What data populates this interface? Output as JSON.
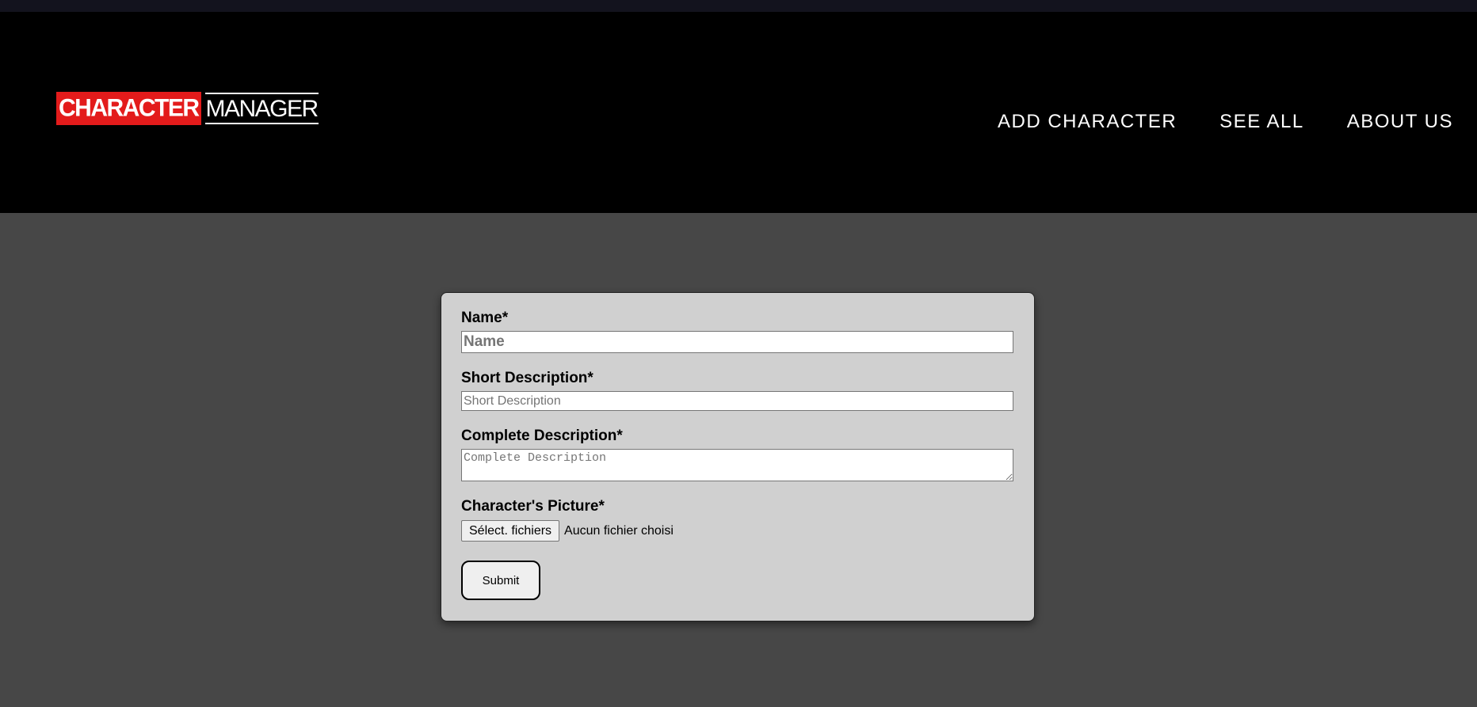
{
  "logo": {
    "red_text": "CHARACTER",
    "white_text": "MANAGER"
  },
  "nav": {
    "items": [
      {
        "label": "ADD CHARACTER"
      },
      {
        "label": "SEE ALL"
      },
      {
        "label": "ABOUT US"
      }
    ]
  },
  "form": {
    "name": {
      "label": "Name*",
      "placeholder": "Name",
      "value": ""
    },
    "short_description": {
      "label": "Short Description*",
      "placeholder": "Short Description",
      "value": ""
    },
    "complete_description": {
      "label": "Complete Description*",
      "placeholder": "Complete Description",
      "value": ""
    },
    "picture": {
      "label": "Character's Picture*",
      "button_label": "Sélect. fichiers",
      "status": "Aucun fichier choisi"
    },
    "submit_label": "Submit"
  },
  "colors": {
    "page_bg": "#474747",
    "header_bg": "#000000",
    "logo_red": "#e31b1b",
    "card_bg": "#d0d0d0"
  }
}
